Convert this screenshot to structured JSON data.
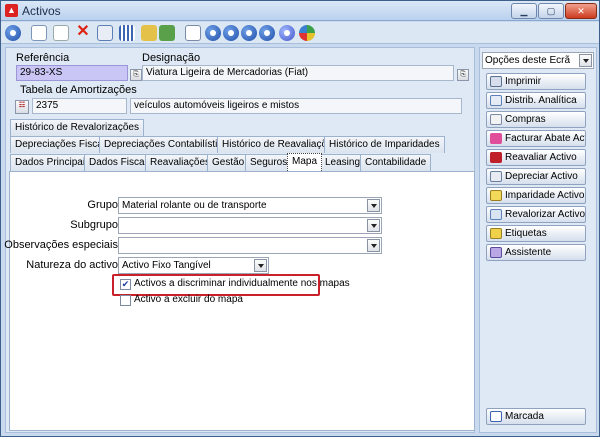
{
  "window": {
    "title": "Activos",
    "minimize_label": "▁",
    "maximize_label": "▢",
    "close_label": "✕"
  },
  "form": {
    "referencia_label": "Referência",
    "referencia_value": "29-83-XS",
    "designacao_label": "Designação",
    "designacao_value": "Viatura Ligeira de Mercadorias (Fiat)",
    "tabela_label": "Tabela de Amortizações",
    "tabela_code": "2375",
    "tabela_desc": "veículos automóveis ligeiros e mistos"
  },
  "tabs_row1": [
    "Histórico de Revalorizações"
  ],
  "tabs_row2": [
    "Depreciações Fiscais",
    "Depreciações Contabilísticas",
    "Histórico de Reavaliações",
    "Histórico de Imparidades"
  ],
  "tabs_row3": [
    "Dados Principais",
    "Dados Fiscais",
    "Reavaliações",
    "Gestão",
    "Seguros",
    "Mapa",
    "Leasing",
    "Contabilidade"
  ],
  "mapa": {
    "grupo_label": "Grupo",
    "grupo_value": "Material rolante ou de transporte",
    "subgrupo_label": "Subgrupo",
    "subgrupo_value": "",
    "obs_label": "Observações especiais",
    "obs_value": "",
    "natureza_label": "Natureza do activo",
    "natureza_value": "Activo Fixo Tangível",
    "check1_label": "Activos a discriminar individualmente nos mapas",
    "check1_checked": "✔",
    "check2_label": "Activo a excluir do mapa"
  },
  "side": {
    "select_value": "Opções deste Ecrã",
    "buttons": [
      "Imprimir",
      "Distrib. Analítica",
      "Compras",
      "Facturar Abate Activo",
      "Reavaliar Activo",
      "Depreciar Activo",
      "Imparidade Activo",
      "Revalorizar Activo",
      "Etiquetas",
      "Assistente"
    ],
    "bottom_button": "Marcada"
  },
  "colors": {
    "accent": "#c9202a",
    "referencia_bg": "#c9c6f5"
  }
}
